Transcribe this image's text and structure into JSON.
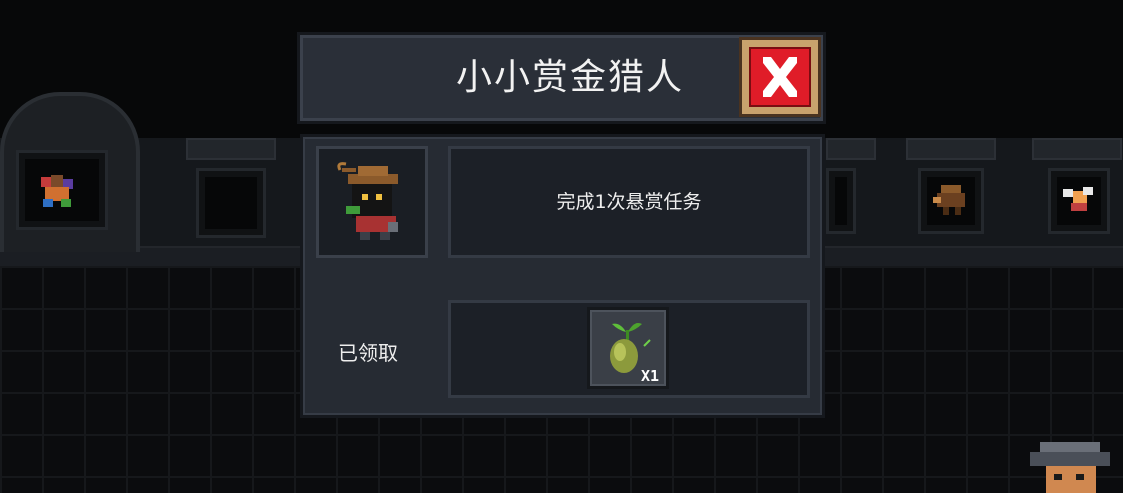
{
  "dialog": {
    "title": "小小赏金猎人",
    "description": "完成1次悬赏任务",
    "status": "已领取",
    "reward": {
      "icon": "seed-sprout-icon",
      "quantity": "X1"
    },
    "close_icon": "close-x-icon",
    "portrait_icon": "bounty-hunter-portrait-icon"
  },
  "colors": {
    "panel": "#262b33",
    "title_bar": "#2a2f38",
    "close_red": "#e01c28",
    "close_frame": "#c9a26d",
    "text": "#eeeeee"
  }
}
